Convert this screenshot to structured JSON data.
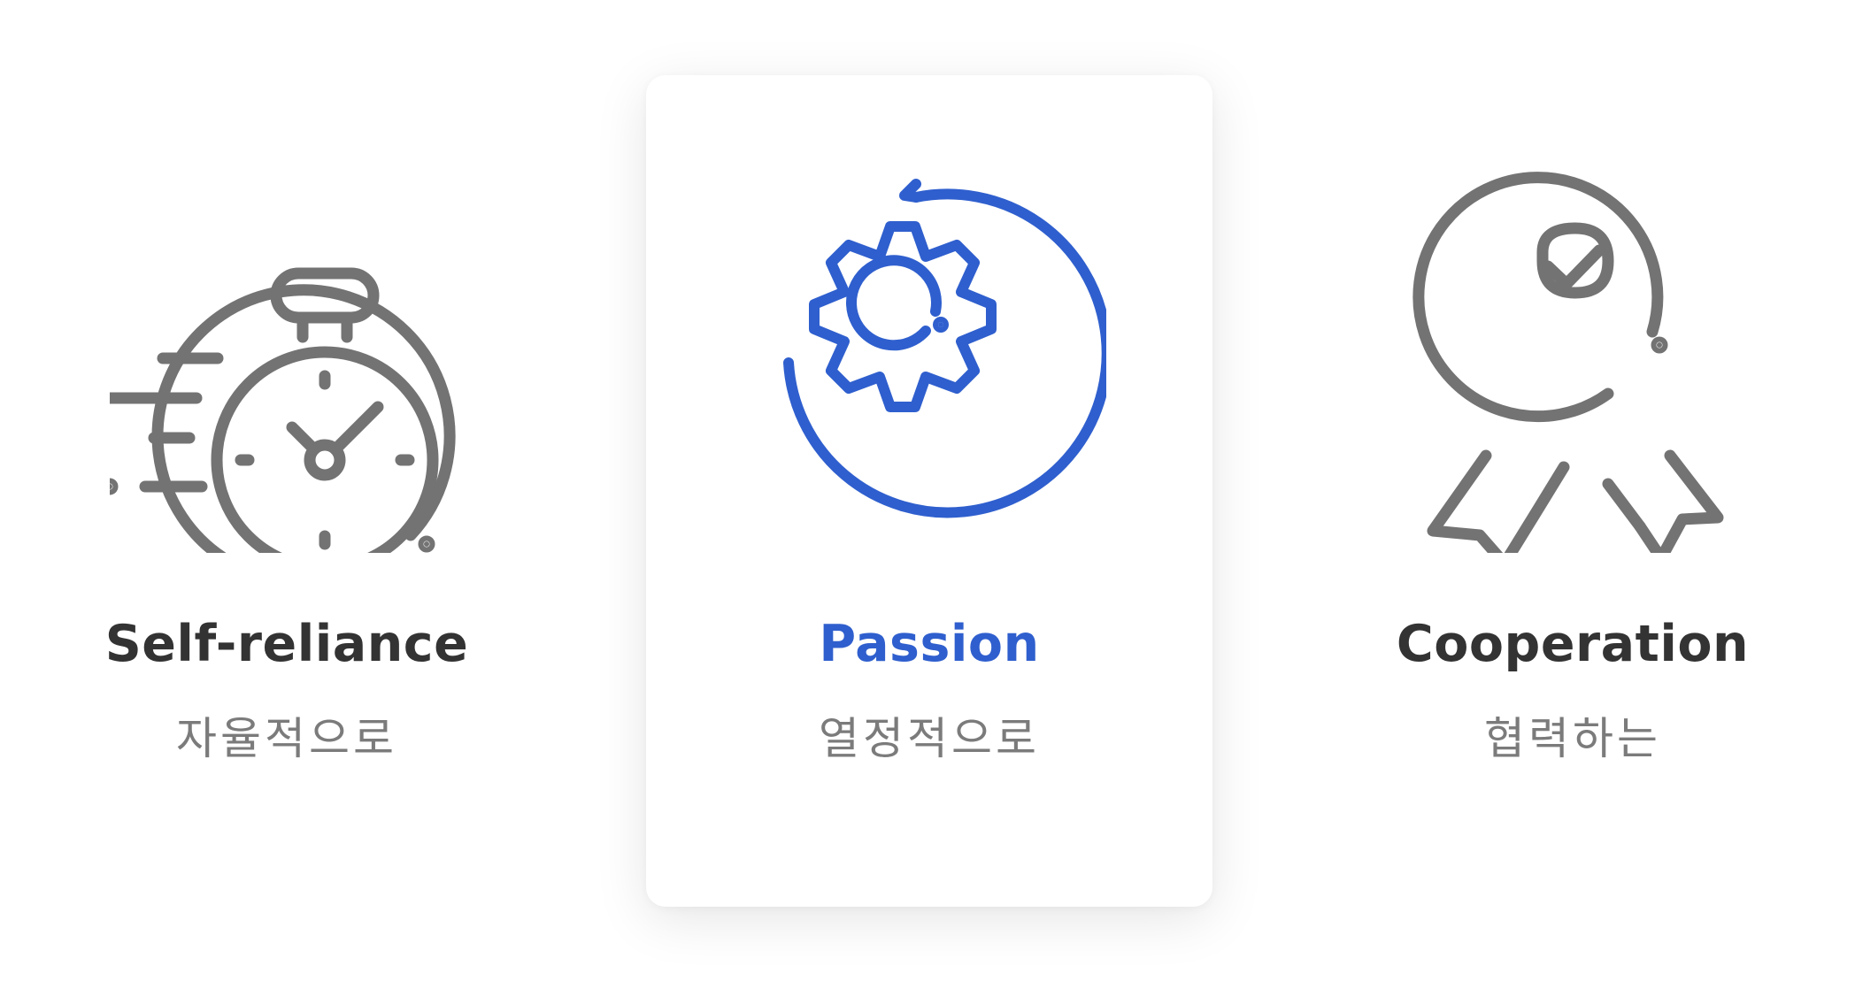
{
  "colors": {
    "text_dark": "#333333",
    "text_muted": "#7b7b7b",
    "icon_gray": "#737373",
    "accent": "#2f5fce",
    "card_background": "#ffffff"
  },
  "values": [
    {
      "icon": "stopwatch-icon",
      "title": "Self-reliance",
      "subtitle": "자율적으로",
      "highlighted": false
    },
    {
      "icon": "gear-cycle-icon",
      "title": "Passion",
      "subtitle": "열정적으로",
      "highlighted": true
    },
    {
      "icon": "award-badge-icon",
      "title": "Cooperation",
      "subtitle": "협력하는",
      "highlighted": false
    }
  ]
}
